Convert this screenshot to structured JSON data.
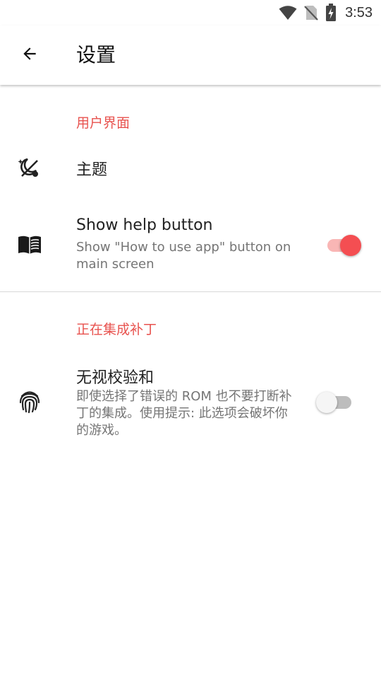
{
  "status_bar": {
    "time": "3:53",
    "icons": [
      "wifi-icon",
      "no-sim-icon",
      "battery-charging-icon"
    ]
  },
  "app_bar": {
    "back_icon": "arrow-left-icon",
    "title": "设置"
  },
  "sections": [
    {
      "header": "用户界面",
      "items": [
        {
          "icon": "theme-icon",
          "title": "主题"
        },
        {
          "icon": "book-open-icon",
          "title": "Show help button",
          "summary": "Show \"How to use app\" button on main screen",
          "switch_on": true
        }
      ]
    },
    {
      "header": "正在集成补丁",
      "items": [
        {
          "icon": "fingerprint-icon",
          "title": "无视校验和",
          "summary": "即使选择了错误的 ROM 也不要打断补丁的集成。使用提示: 此选项会破坏你的游戏。",
          "switch_on": false
        }
      ]
    }
  ],
  "colors": {
    "accent": "#f44e52",
    "section_header": "#e8534f",
    "switch_track_on": "#f9b6b5",
    "switch_track_off": "#bdbdbd",
    "summary_text": "#757575"
  }
}
